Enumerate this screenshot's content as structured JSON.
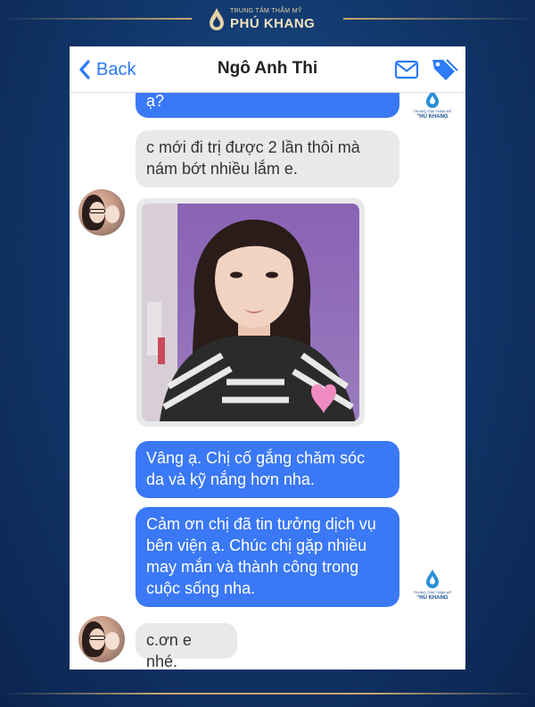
{
  "brand": {
    "tagline": "TRUNG TÂM THẨM MỸ",
    "name": "PHÚ KHANG",
    "badge_tagline": "TRUNG TÂM THẨM MỸ",
    "badge_name": "\"HÚ KHANG"
  },
  "nav": {
    "back_label": "Back",
    "title": "Ngô Anh Thi",
    "mail_icon": "mail-icon",
    "tag_icon": "tag-icon",
    "accent_color": "#2d7bf6"
  },
  "messages": [
    {
      "side": "sent",
      "text": "ạ?"
    },
    {
      "side": "recv",
      "lines": [
        "c mới đi trị được 2 lần thôi mà",
        "nám bớt nhiều lắm e."
      ]
    },
    {
      "side": "recv",
      "type": "photo"
    },
    {
      "side": "sent",
      "lines": [
        "Vâng ạ. Chị cố gắng chăm sóc",
        "da và kỹ nắng hơn nha."
      ]
    },
    {
      "side": "sent",
      "lines": [
        "Cảm ơn chị đã tin tưởng dịch vụ",
        "bên viện ạ. Chúc chị gặp nhiều",
        "may mắn và thành công trong",
        "cuộc sống nha."
      ]
    },
    {
      "side": "recv",
      "text": "c.ơn e nhé."
    }
  ],
  "colors": {
    "sent_bubble": "#3a78f5",
    "recv_bubble": "#e9e9eb",
    "background": "#12386c",
    "gold": "#c9a86a"
  }
}
